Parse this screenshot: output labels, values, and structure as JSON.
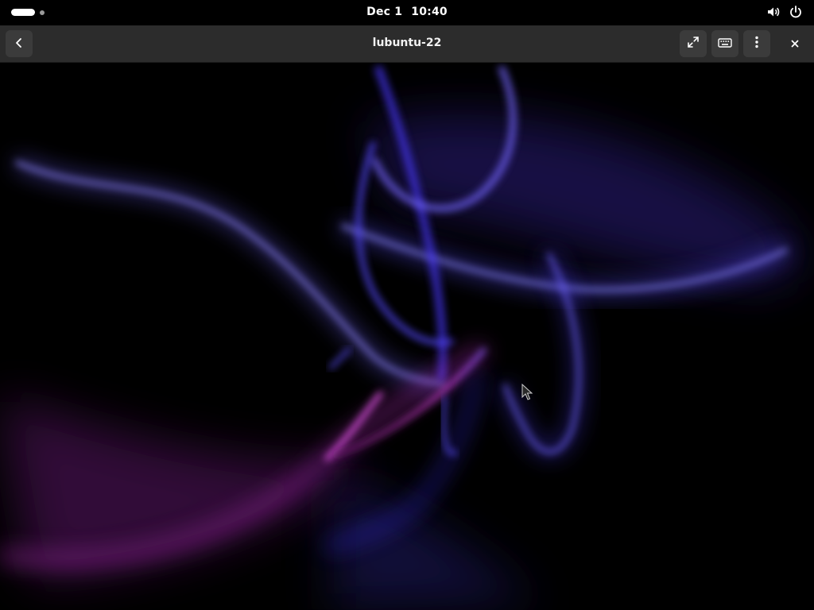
{
  "topbar": {
    "date": "Dec 1",
    "time": "10:40",
    "icons": [
      "speaker-icon",
      "power-icon"
    ]
  },
  "headerbar": {
    "title": "lubuntu-22",
    "buttons": [
      "back-button",
      "fullscreen-button",
      "keyboard-button",
      "menu-button",
      "close-button"
    ]
  },
  "remote_desktop": {
    "content": "abstract wallpaper",
    "colors": {
      "accent_blue": "#6a5cff",
      "accent_magenta": "#e040e0",
      "background": "#000000"
    }
  }
}
